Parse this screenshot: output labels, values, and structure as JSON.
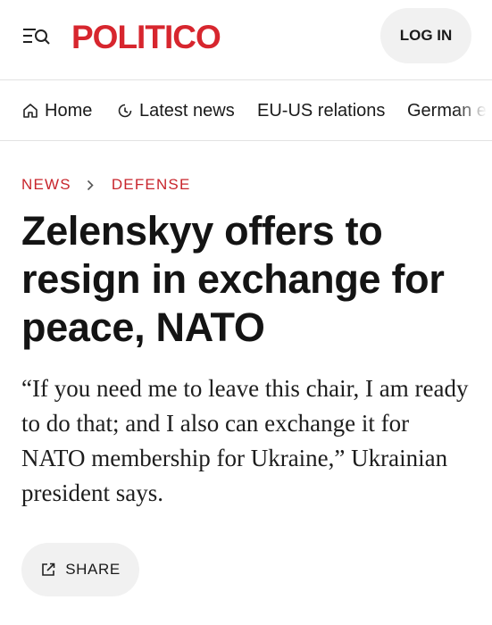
{
  "header": {
    "logo_text": "POLITICO",
    "login_label": "LOG IN",
    "menu_icon": "menu-search-icon"
  },
  "nav": {
    "items": [
      {
        "label": "Home",
        "icon": "home-icon"
      },
      {
        "label": "Latest news",
        "icon": "clock-icon"
      },
      {
        "label": "EU-US relations"
      },
      {
        "label": "German e"
      }
    ]
  },
  "breadcrumb": {
    "items": [
      "NEWS",
      "DEFENSE"
    ]
  },
  "article": {
    "title": "Zelenskyy offers to resign in exchange for peace, NATO",
    "dek": "“If you need me to leave this chair, I am ready to do that; and I also can exchange it for NATO membership for Ukraine,” Ukrainian president says."
  },
  "share": {
    "label": "SHARE",
    "icon": "share-external-icon"
  },
  "colors": {
    "brand_red": "#d7262e",
    "pill_bg": "#f1f1f1",
    "divider": "#e2e2e2"
  }
}
